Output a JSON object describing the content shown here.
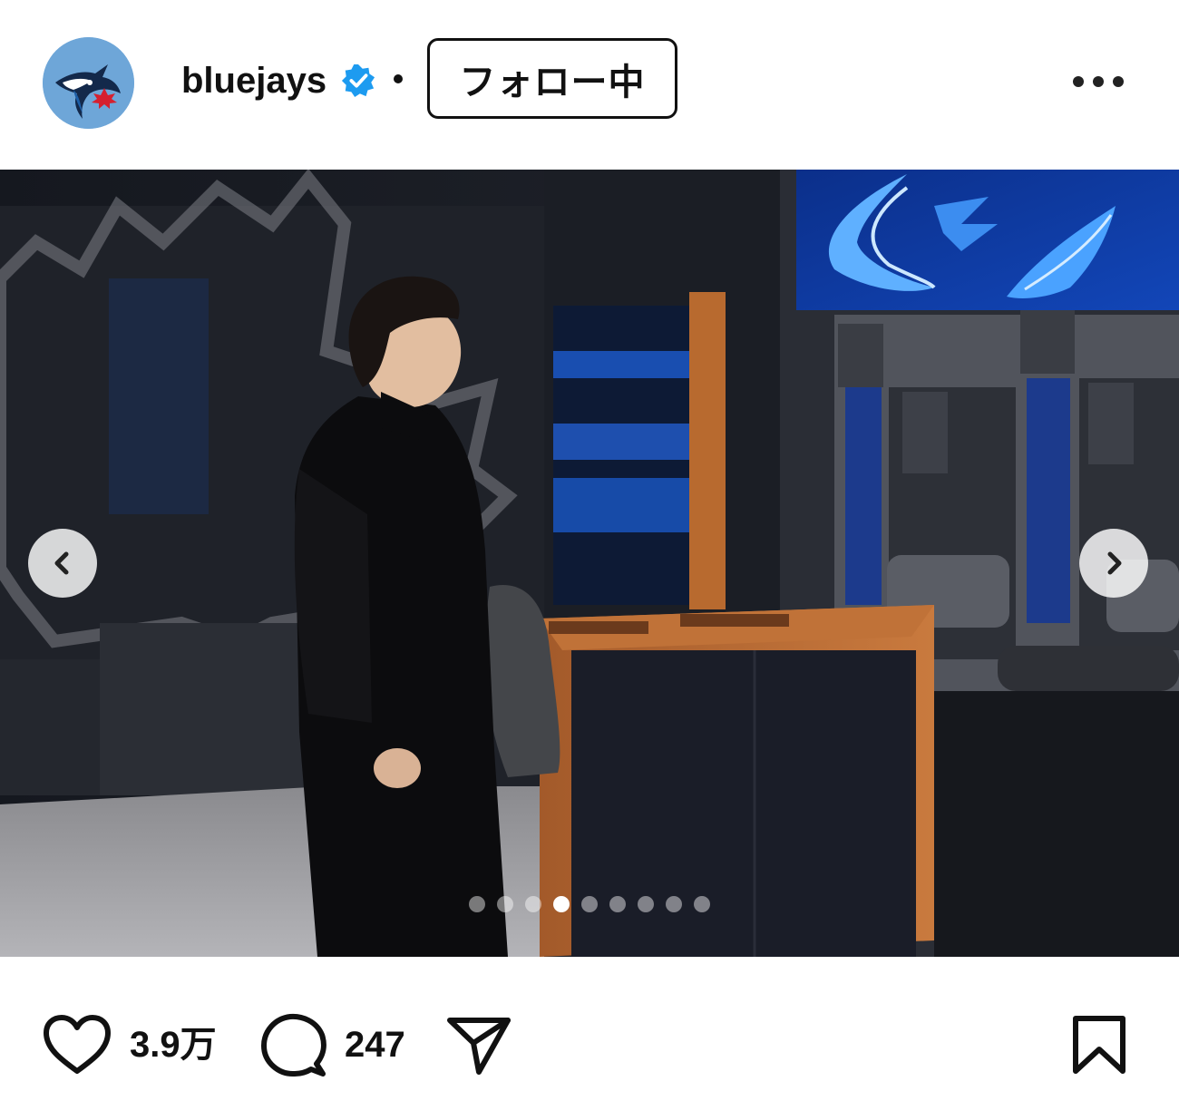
{
  "header": {
    "username": "bluejays",
    "separator": "•",
    "follow_label": "フォロー中"
  },
  "post": {
    "carousel": {
      "total_slides": 9,
      "active_index": 3
    }
  },
  "actions": {
    "likes": "3.9万",
    "comments": "247"
  },
  "colors": {
    "avatar_bg": "#6ea6d8",
    "verified_blue": "#1d9bf0",
    "text": "#111111"
  },
  "icons": [
    "bluejays-logo-icon",
    "verified-badge-icon",
    "more-options-icon",
    "chevron-left-icon",
    "chevron-right-icon",
    "heart-icon",
    "comment-icon",
    "share-icon",
    "bookmark-icon"
  ]
}
